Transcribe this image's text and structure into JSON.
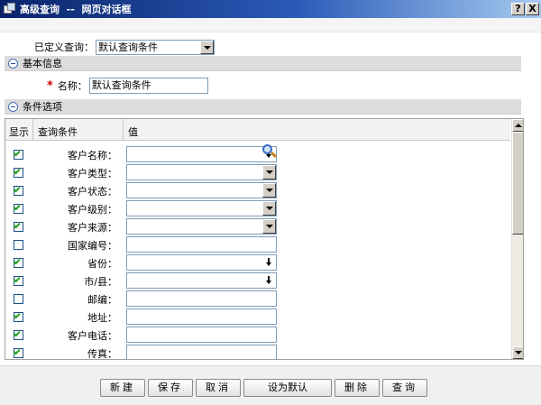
{
  "window": {
    "title": "高级查询  --  网页对话框",
    "help_label": "?",
    "close_label": "X"
  },
  "predefined": {
    "label": "已定义查询：",
    "selected": "默认查询条件"
  },
  "basic_section": {
    "title": "基本信息"
  },
  "name_field": {
    "required_mark": "*",
    "label": "名称：",
    "value": "默认查询条件"
  },
  "condition_section": {
    "title": "条件选项"
  },
  "grid": {
    "headers": {
      "show": "显示",
      "condition": "查询条件",
      "value": "值"
    },
    "rows": [
      {
        "label": "客户名称：",
        "checked": true,
        "type": "pick"
      },
      {
        "label": "客户类型：",
        "checked": true,
        "type": "select"
      },
      {
        "label": "客户状态：",
        "checked": true,
        "type": "select"
      },
      {
        "label": "客户级别：",
        "checked": true,
        "type": "select"
      },
      {
        "label": "客户来源：",
        "checked": true,
        "type": "select"
      },
      {
        "label": "国家编号：",
        "checked": false,
        "type": "text"
      },
      {
        "label": "省份：",
        "checked": true,
        "type": "pick"
      },
      {
        "label": "市/县：",
        "checked": true,
        "type": "pick"
      },
      {
        "label": "邮编：",
        "checked": false,
        "type": "text"
      },
      {
        "label": "地址：",
        "checked": true,
        "type": "text"
      },
      {
        "label": "客户电话：",
        "checked": true,
        "type": "text"
      },
      {
        "label": "传真：",
        "checked": true,
        "type": "text"
      }
    ]
  },
  "buttons": {
    "new": "新建",
    "save": "保存",
    "cancel": "取消",
    "set_default": "设为默认",
    "delete": "删除",
    "query": "查询"
  }
}
